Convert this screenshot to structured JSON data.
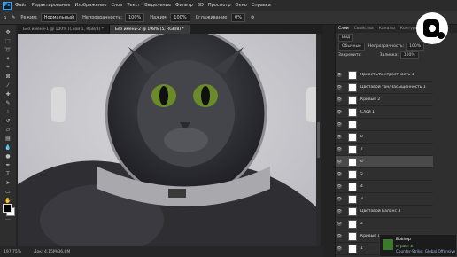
{
  "app": {
    "name": "Ps"
  },
  "menu": [
    "Файл",
    "Редактирование",
    "Изображение",
    "Слои",
    "Текст",
    "Выделение",
    "Фильтр",
    "3D",
    "Просмотр",
    "Окно",
    "Справка"
  ],
  "options": {
    "pattern_label": "Режим:",
    "mode_value": "Нормальный",
    "opacity_label": "Непрозрачность:",
    "opacity_value": "100%",
    "pressure_label": "Нажим:",
    "pressure_value": "100%",
    "smoothing_label": "Сглаживание:",
    "smoothing_value": "0%"
  },
  "tabs": [
    {
      "label": "Без имени-1 @ 100% (Слой 1, RGB/8) *",
      "active": false
    },
    {
      "label": "Без имени-2 @ 198% (5, RGB/8) *",
      "active": true
    }
  ],
  "statusbar": {
    "zoom": "197.75%",
    "doc": "Док: 4,15М/36,6М"
  },
  "layers_panel": {
    "tabs": [
      "Слои",
      "Свойства",
      "Каналы",
      "Контуры"
    ],
    "kind_label": "Вид",
    "blend_mode": "Обычные",
    "opacity_label": "Непрозрачность:",
    "opacity_value": "100%",
    "lock_label": "Закрепить:",
    "fill_label": "Заливка:",
    "fill_value": "100%",
    "layers": [
      {
        "name": "Яркость/Контрастность 1",
        "selected": false
      },
      {
        "name": "Цветовой тон/Насыщенность 1",
        "selected": false
      },
      {
        "name": "Кривые 2",
        "selected": false
      },
      {
        "name": "Слой 1",
        "selected": false
      },
      {
        "name": "",
        "selected": false
      },
      {
        "name": "8",
        "selected": false
      },
      {
        "name": "7",
        "selected": false
      },
      {
        "name": "6",
        "selected": true
      },
      {
        "name": "5",
        "selected": false
      },
      {
        "name": "4",
        "selected": false
      },
      {
        "name": "3",
        "selected": false
      },
      {
        "name": "Цветовой Баланс 3",
        "selected": false
      },
      {
        "name": "2",
        "selected": false
      },
      {
        "name": "Кривые 1",
        "selected": false
      },
      {
        "name": "1",
        "selected": false
      }
    ]
  },
  "notification": {
    "title": "Bokhop",
    "subtitle": "играет в",
    "game": "Counter-Strike: Global Offensive"
  }
}
